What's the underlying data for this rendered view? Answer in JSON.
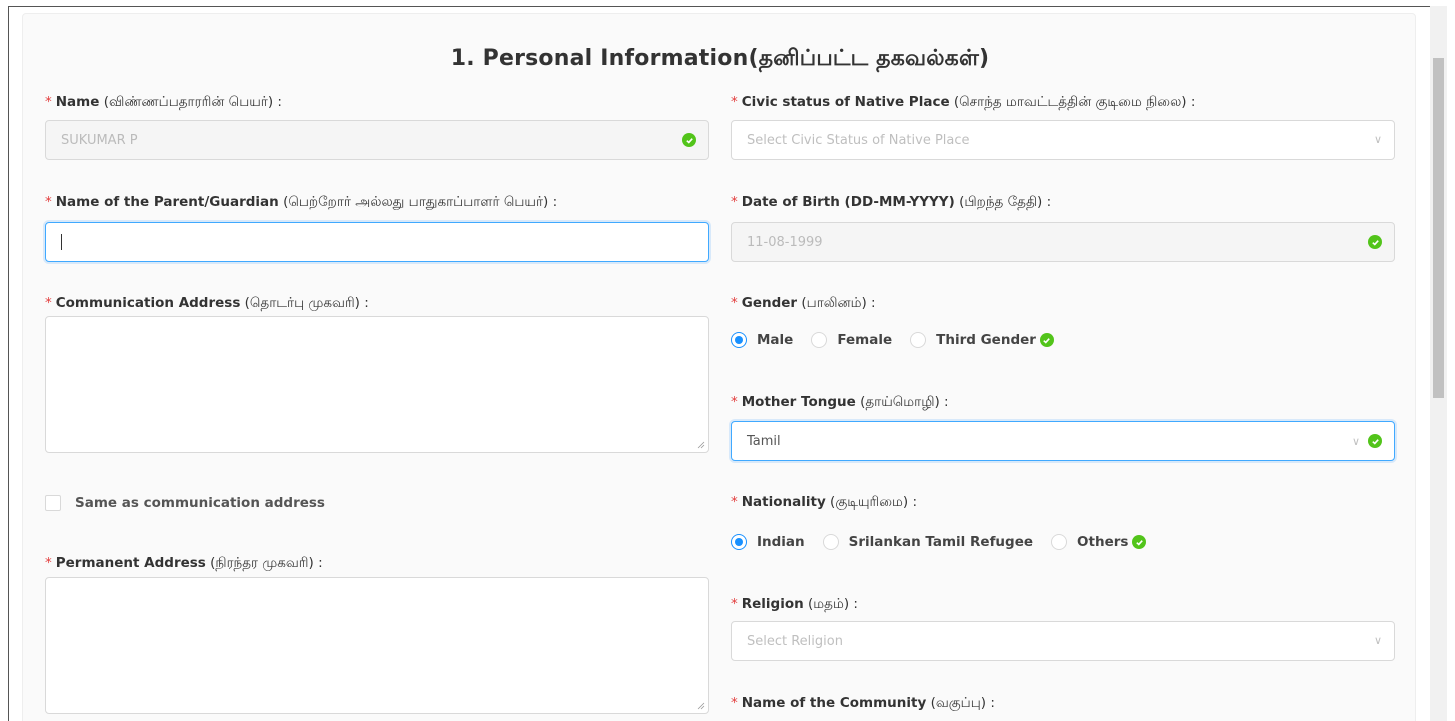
{
  "section": {
    "title": "1. Personal Information(தனிப்பட்ட தகவல்கள்)"
  },
  "fields": {
    "name": {
      "label_en": "Name",
      "label_ta": "(விண்ணப்பதாரரின் பெயர்) :",
      "value": "SUKUMAR P"
    },
    "civic_status": {
      "label_en": "Civic status of Native Place",
      "label_ta": "(சொந்த மாவட்டத்தின் குடிமை நிலை) :",
      "placeholder": "Select Civic Status of Native Place"
    },
    "parent": {
      "label_en": "Name of the Parent/Guardian",
      "label_ta": "(பெற்றோர் அல்லது பாதுகாப்பாளர் பெயர்) :",
      "value": ""
    },
    "dob": {
      "label_en": "Date of Birth (DD-MM-YYYY)",
      "label_ta": "(பிறந்த தேதி) :",
      "value": "11-08-1999"
    },
    "comm_address": {
      "label_en": "Communication Address",
      "label_ta": "(தொடர்பு முகவரி) :",
      "value": ""
    },
    "gender": {
      "label_en": "Gender",
      "label_ta": "(பாலினம்) :",
      "options": [
        "Male",
        "Female",
        "Third Gender"
      ],
      "selected": "Male"
    },
    "mother_tongue": {
      "label_en": "Mother Tongue",
      "label_ta": "(தாய்மொழி) :",
      "value": "Tamil"
    },
    "same_as": {
      "label": "Same as communication address",
      "checked": false
    },
    "nationality": {
      "label_en": "Nationality",
      "label_ta": "(குடியுரிமை) :",
      "options": [
        "Indian",
        "Srilankan Tamil Refugee",
        "Others"
      ],
      "selected": "Indian"
    },
    "perm_address": {
      "label_en": "Permanent Address",
      "label_ta": "(நிரந்தர முகவரி) :",
      "value": ""
    },
    "religion": {
      "label_en": "Religion",
      "label_ta": "(மதம்) :",
      "placeholder": "Select Religion"
    },
    "community": {
      "label_en": "Name of the Community",
      "label_ta": "(வகுப்பு) :"
    }
  },
  "required_mark": "*",
  "colors": {
    "accent": "#1890ff",
    "required": "#e23c3c",
    "valid": "#52c41a",
    "border": "#d9d9d9",
    "disabled_bg": "#f5f5f5"
  },
  "icons": {
    "valid": "check-circle-icon",
    "dropdown": "chevron-down-icon",
    "resize": "resize-handle-icon"
  }
}
